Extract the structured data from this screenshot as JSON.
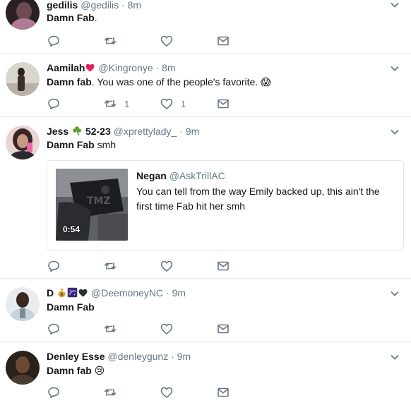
{
  "tweets": [
    {
      "name": "gedilis",
      "handle": "@gedilis",
      "time": "8m",
      "text_bold": "Damn Fab",
      "text_rest": ".",
      "retweets": "",
      "likes": ""
    },
    {
      "name": "Aamilah",
      "name_emoji": "❤️",
      "handle": "@Kingronye",
      "time": "8m",
      "text_bold": "Damn fab",
      "text_rest": ". You was one of the people's favorite. 😱",
      "retweets": "1",
      "likes": "1"
    },
    {
      "name": "Jess",
      "name_emoji": "☘️",
      "name_suffix": "52-23",
      "handle": "@xprettylady_",
      "time": "9m",
      "text_bold": "Damn Fab",
      "text_rest": " smh",
      "retweets": "",
      "likes": "",
      "quote": {
        "name": "Negan",
        "handle": "@AskTrillAC",
        "text": "You can tell from the way Emily backed up, this ain't the first time Fab hit her smh",
        "duration": "0:54"
      }
    },
    {
      "name": "D",
      "name_emoji": "💰🌌🖤",
      "handle": "@DeemoneyNC",
      "time": "9m",
      "text_bold": "Damn Fab",
      "text_rest": "",
      "retweets": "",
      "likes": ""
    },
    {
      "name": "Denley Esse",
      "handle": "@denleygunz",
      "time": "9m",
      "text_bold": "Damn fab",
      "text_rest": " 😢",
      "retweets": "",
      "likes": ""
    }
  ],
  "dot": "·",
  "colors": {
    "secondary": "#657786",
    "border": "#e6ecf0",
    "heart": "#e0245e"
  },
  "icons": [
    "reply-icon",
    "retweet-icon",
    "like-icon",
    "direct-message-icon",
    "chevron-down-icon"
  ]
}
